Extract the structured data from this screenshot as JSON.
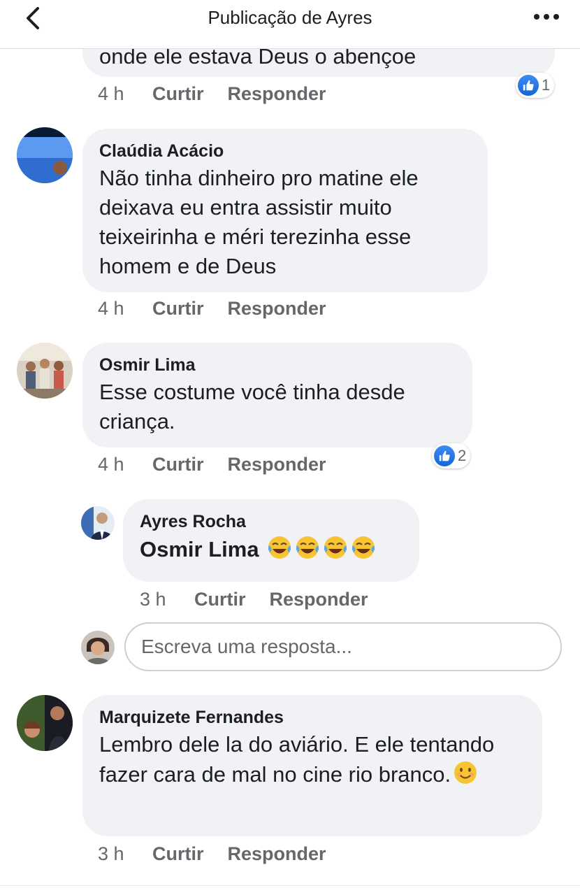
{
  "header": {
    "title": "Publicação de Ayres"
  },
  "comments": [
    {
      "text": "onde ele estava Deus o abençoe",
      "time": "4 h",
      "like_label": "Curtir",
      "reply_label": "Responder",
      "reactions": "1"
    },
    {
      "author": "Claúdia Acácio",
      "text": "Não tinha dinheiro pro matine ele deixava eu entra assistir muito teixeirinha e méri terezinha esse homem e de Deus",
      "time": "4 h",
      "like_label": "Curtir",
      "reply_label": "Responder"
    },
    {
      "author": "Osmir Lima",
      "text": "Esse costume você tinha desde criança.",
      "time": "4 h",
      "like_label": "Curtir",
      "reply_label": "Responder",
      "reactions": "2"
    },
    {
      "author": "Ayres Rocha",
      "mention": "Osmir Lima",
      "emojis": [
        "tears-of-joy-emoji",
        "tears-of-joy-emoji",
        "tears-of-joy-emoji",
        "tears-of-joy-emoji"
      ],
      "time": "3 h",
      "like_label": "Curtir",
      "reply_label": "Responder"
    },
    {
      "author": "Marquizete Fernandes",
      "text": "Lembro dele la do aviário. E ele tentando fazer cara de mal no cine rio branco.",
      "emoji": "smiling-face-emoji",
      "time": "3 h",
      "like_label": "Curtir",
      "reply_label": "Responder"
    }
  ],
  "reply_box": {
    "placeholder": "Escreva uma resposta..."
  },
  "colors": {
    "bubble": "#f0f2f5",
    "like_blue": "#1877f2",
    "meta_gray": "#65676b"
  }
}
